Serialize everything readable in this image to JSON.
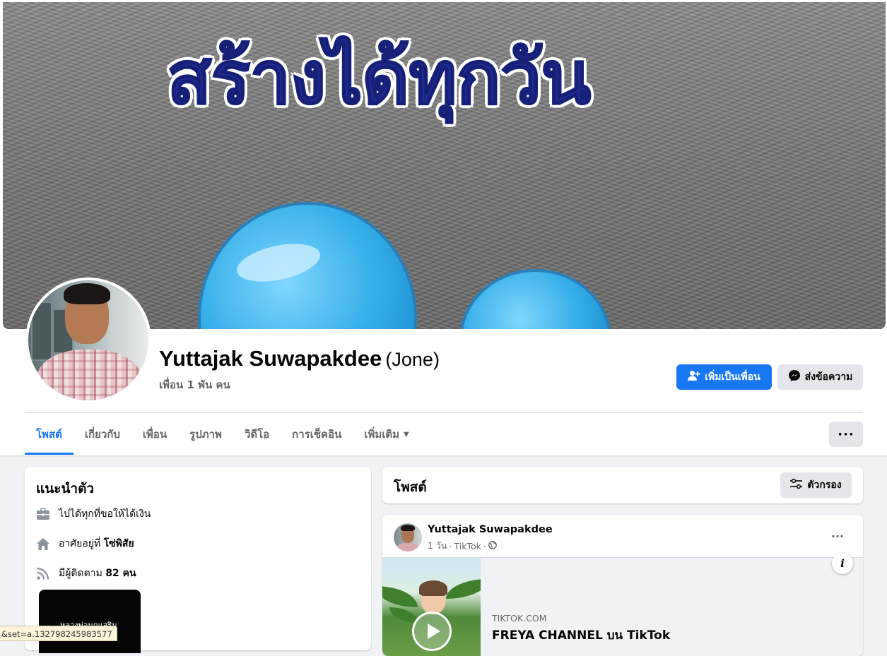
{
  "cover": {
    "text": "สร้างได้ทุกวัน"
  },
  "profile": {
    "name": "Yuttajak Suwapakdee",
    "alt_name": "(Jone)",
    "friends": "เพื่อน 1 พัน คน"
  },
  "actions": {
    "add_friend": "เพิ่มเป็นเพื่อน",
    "message": "ส่งข้อความ",
    "more": "···"
  },
  "tabs": [
    {
      "label": "โพสต์",
      "active": true
    },
    {
      "label": "เกี่ยวกับ"
    },
    {
      "label": "เพื่อน"
    },
    {
      "label": "รูปภาพ"
    },
    {
      "label": "วิดีโอ"
    },
    {
      "label": "การเช็คอิน"
    },
    {
      "label": "เพิ่มเติม",
      "has_caret": true
    }
  ],
  "intro": {
    "title": "แนะนำตัว",
    "work": "ไปได้ทุกที่ขอให้ได้เงิน",
    "lives_prefix": "อาศัยอยู่ที่ ",
    "lives_place": "โซ่พิสัย",
    "followers_prefix": "มีผู้ติดตาม ",
    "followers_count": "82 คน",
    "thumb_text": "หลวงพ่อนกแสริม"
  },
  "posts": {
    "title": "โพสต์",
    "filter": "ตัวกรอง",
    "items": [
      {
        "author": "Yuttajak Suwapakdee",
        "time": "1 วัน",
        "source": "TikTok",
        "link_domain": "TIKTOK.COM",
        "link_title": "FREYA CHANNEL บน TikTok",
        "more": "···",
        "info": "i"
      }
    ]
  },
  "status_bar": {
    "url": "&set=a.132798245983577"
  },
  "colors": {
    "accent": "#1877f2",
    "page_bg": "#f0f2f5",
    "secondary_button": "#e4e6eb",
    "cover_text": "#1f2a8c"
  },
  "icons": {
    "add_friend": "person-plus-icon",
    "message": "messenger-icon",
    "work": "briefcase-icon",
    "home": "home-icon",
    "followers": "rss-icon",
    "filter": "sliders-icon",
    "privacy": "globe-icon"
  }
}
